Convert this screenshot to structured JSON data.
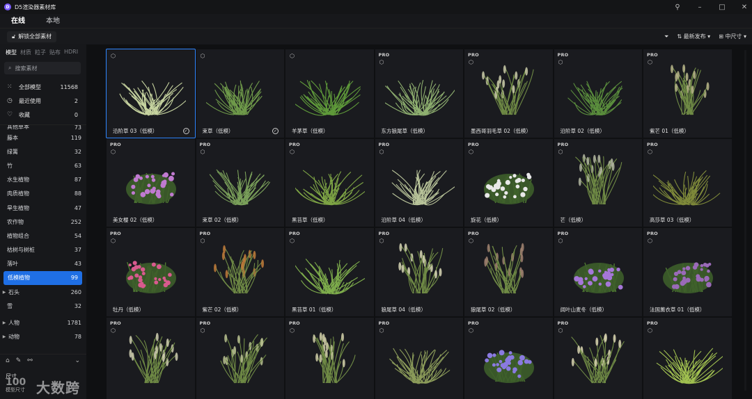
{
  "app": {
    "title": "D5渲染器素材库",
    "logo": "D"
  },
  "top_tabs": [
    {
      "label": "在线",
      "active": true
    },
    {
      "label": "本地",
      "active": false
    }
  ],
  "toolbar": {
    "unlock_label": "解锁全部素材",
    "sort_label": "最新发布",
    "size_label": "中尺寸"
  },
  "sidebar": {
    "category_tabs": [
      {
        "label": "模型",
        "active": true
      },
      {
        "label": "材质",
        "active": false
      },
      {
        "label": "粒子",
        "active": false
      },
      {
        "label": "贴布",
        "active": false
      },
      {
        "label": "HDRI",
        "active": false
      }
    ],
    "search_placeholder": "搜索素材",
    "main_items": [
      {
        "label": "全部模型",
        "count": "11568",
        "icon": "grid-icon"
      },
      {
        "label": "最近使用",
        "count": "2",
        "icon": "history-icon"
      },
      {
        "label": "收藏",
        "count": "0",
        "icon": "heart-icon"
      }
    ],
    "sub_items": [
      {
        "label": "其他草本",
        "count": "73"
      },
      {
        "label": "藤本",
        "count": "119"
      },
      {
        "label": "绿篱",
        "count": "32"
      },
      {
        "label": "竹",
        "count": "63"
      },
      {
        "label": "水生植物",
        "count": "87"
      },
      {
        "label": "肉质植物",
        "count": "88"
      },
      {
        "label": "旱生植物",
        "count": "47"
      },
      {
        "label": "农作物",
        "count": "252"
      },
      {
        "label": "植物组合",
        "count": "54"
      },
      {
        "label": "枯树与树桩",
        "count": "37"
      },
      {
        "label": "落叶",
        "count": "43"
      },
      {
        "label": "低模植物",
        "count": "99"
      },
      {
        "label": "石头",
        "count": "260"
      },
      {
        "label": "雪",
        "count": "32"
      },
      {
        "label": "人物",
        "count": "1781"
      },
      {
        "label": "动物",
        "count": "78"
      }
    ],
    "bottom_label": "尺寸",
    "bottom_sublabel": "模型尺寸",
    "watermark": "大数跨境",
    "watermark_logo": "100"
  },
  "cards": [
    {
      "name": "沿阶草 03（低模）",
      "pro": "",
      "plant": "grass",
      "color": "#c7d4a0",
      "selected": true,
      "check": true
    },
    {
      "name": "束草（低模）",
      "pro": "",
      "plant": "grass",
      "color": "#6f9a4a",
      "selected": false,
      "check": true
    },
    {
      "name": "羊茅草（低模）",
      "pro": "",
      "plant": "grass",
      "color": "#5f9a3a",
      "selected": false,
      "check": false
    },
    {
      "name": "东方狼尾草（低模）",
      "pro": "PRO",
      "plant": "grass",
      "color": "#8fb070",
      "selected": false,
      "check": false
    },
    {
      "name": "墨西哥羽毛草 02（低模）",
      "pro": "PRO",
      "plant": "plume",
      "color": "#c9c9a8",
      "selected": false,
      "check": false
    },
    {
      "name": "沿阶草 02（低模）",
      "pro": "PRO",
      "plant": "grass",
      "color": "#5b8f3d",
      "selected": false,
      "check": false
    },
    {
      "name": "紫芒 01（低模）",
      "pro": "PRO",
      "plant": "plume",
      "color": "#b8b58a",
      "selected": false,
      "check": false
    },
    {
      "name": "美女樱 02（低模）",
      "pro": "PRO",
      "plant": "flower",
      "color": "#c07ad0",
      "selected": false,
      "check": false
    },
    {
      "name": "束草 02（低模）",
      "pro": "PRO",
      "plant": "grass",
      "color": "#7aa05a",
      "selected": false,
      "check": false
    },
    {
      "name": "黑苔草（低模）",
      "pro": "PRO",
      "plant": "grass",
      "color": "#7ea545",
      "selected": false,
      "check": false
    },
    {
      "name": "沿阶草 04（低模）",
      "pro": "PRO",
      "plant": "grass",
      "color": "#b9c49a",
      "selected": false,
      "check": false
    },
    {
      "name": "旋花（低模）",
      "pro": "PRO",
      "plant": "flower",
      "color": "#e8e8e8",
      "selected": false,
      "check": false
    },
    {
      "name": "芒（低模）",
      "pro": "PRO",
      "plant": "plume",
      "color": "#b2b5a0",
      "selected": false,
      "check": false
    },
    {
      "name": "高莎草 03（低模）",
      "pro": "PRO",
      "plant": "grass",
      "color": "#7f8a3a",
      "selected": false,
      "check": false
    },
    {
      "name": "牡丹（低模）",
      "pro": "PRO",
      "plant": "flower",
      "color": "#d85a8e",
      "selected": false,
      "check": false
    },
    {
      "name": "紫芒 02（低模）",
      "pro": "PRO",
      "plant": "plume",
      "color": "#c07a3a",
      "selected": false,
      "check": false
    },
    {
      "name": "黑苔草 01（低模）",
      "pro": "PRO",
      "plant": "grass",
      "color": "#7fae4c",
      "selected": false,
      "check": false
    },
    {
      "name": "狼尾草 04（低模）",
      "pro": "PRO",
      "plant": "plume",
      "color": "#d6d4b4",
      "selected": false,
      "check": false
    },
    {
      "name": "狼尾草 02（低模）",
      "pro": "PRO",
      "plant": "plume",
      "color": "#a08070",
      "selected": false,
      "check": false
    },
    {
      "name": "阔叶山麦冬（低模）",
      "pro": "PRO",
      "plant": "flower",
      "color": "#a577d8",
      "selected": false,
      "check": false
    },
    {
      "name": "法国薰衣草 01（低模）",
      "pro": "PRO",
      "plant": "flower",
      "color": "#9a6ab8",
      "selected": false,
      "check": false
    },
    {
      "name": "",
      "pro": "PRO",
      "plant": "plume",
      "color": "#cfcdb0",
      "selected": false,
      "check": false
    },
    {
      "name": "",
      "pro": "PRO",
      "plant": "plume",
      "color": "#b8c090",
      "selected": false,
      "check": false
    },
    {
      "name": "",
      "pro": "PRO",
      "plant": "plume",
      "color": "#d0cca8",
      "selected": false,
      "check": false
    },
    {
      "name": "",
      "pro": "PRO",
      "plant": "grass",
      "color": "#8c9c5a",
      "selected": false,
      "check": false
    },
    {
      "name": "",
      "pro": "PRO",
      "plant": "flower",
      "color": "#8a7ae0",
      "selected": false,
      "check": false
    },
    {
      "name": "",
      "pro": "PRO",
      "plant": "plume",
      "color": "#d8d2b0",
      "selected": false,
      "check": false
    },
    {
      "name": "",
      "pro": "PRO",
      "plant": "grass",
      "color": "#a0c050",
      "selected": false,
      "check": false
    }
  ]
}
